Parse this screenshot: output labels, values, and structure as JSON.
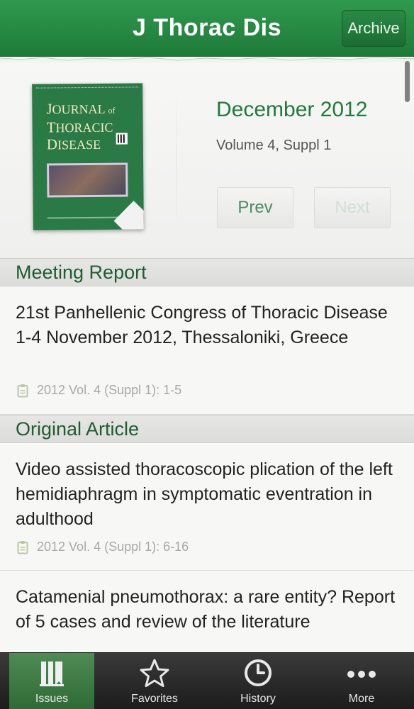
{
  "header": {
    "title": "J Thorac Dis",
    "archive_label": "Archive"
  },
  "issue": {
    "date": "December 2012",
    "volume": "Volume 4, Suppl 1",
    "prev_label": "Prev",
    "next_label": "Next",
    "cover": {
      "line1_cap": "J",
      "line1_rest": "OURNAL",
      "line1_small": "of",
      "line2_cap": "T",
      "line2_rest": "HORACIC",
      "line3_cap": "D",
      "line3_rest": "ISEASE"
    }
  },
  "sections": [
    {
      "name": "Meeting Report",
      "articles": [
        {
          "title": "21st  Panhellenic Congress of Thoracic Disease 1-4 November 2012, Thessaloniki, Greece",
          "meta": "2012 Vol. 4 (Suppl 1): 1-5"
        }
      ]
    },
    {
      "name": "Original Article",
      "articles": [
        {
          "title": "Video assisted thoracoscopic plication of the left hemidiaphragm in symptomatic eventration in adulthood",
          "meta": "2012 Vol. 4 (Suppl 1): 6-16"
        },
        {
          "title": "Catamenial pneumothorax: a rare entity? Report of 5 cases and review of the literature",
          "meta": ""
        }
      ]
    }
  ],
  "tabs": [
    {
      "label": "Issues",
      "icon": "issues-icon",
      "active": true
    },
    {
      "label": "Favorites",
      "icon": "star-icon",
      "active": false
    },
    {
      "label": "History",
      "icon": "clock-icon",
      "active": false
    },
    {
      "label": "More",
      "icon": "more-dots-icon",
      "active": false
    }
  ],
  "colors": {
    "header_green": "#1e7a38",
    "accent_green": "#1f7a3a",
    "tab_active": "#2f6a35"
  }
}
